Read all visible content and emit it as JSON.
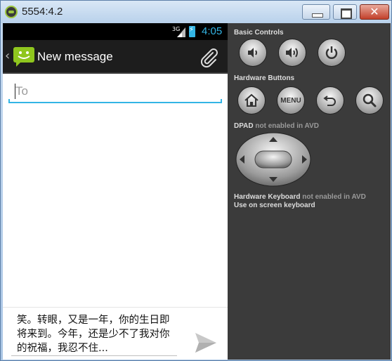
{
  "window": {
    "title": "5554:4.2",
    "close_glyph": "✕"
  },
  "statusbar": {
    "network": "3G",
    "time": "4:05",
    "accent": "#33b5e5"
  },
  "actionbar": {
    "back_glyph": "‹",
    "title": "New message"
  },
  "compose": {
    "to_placeholder": "To",
    "to_value": "",
    "message_text": "笑。转眼，又是一年，你的生日即将来到。今年，还是少不了我对你的祝福，我忍不住..."
  },
  "panel": {
    "basic_controls": "Basic Controls",
    "hardware_buttons": "Hardware Buttons",
    "menu_label": "MENU",
    "dpad_label": "DPAD",
    "dpad_note": "not enabled in AVD",
    "keyboard_label": "Hardware Keyboard",
    "keyboard_note": "not enabled in AVD",
    "keyboard_hint": "Use on screen keyboard"
  }
}
